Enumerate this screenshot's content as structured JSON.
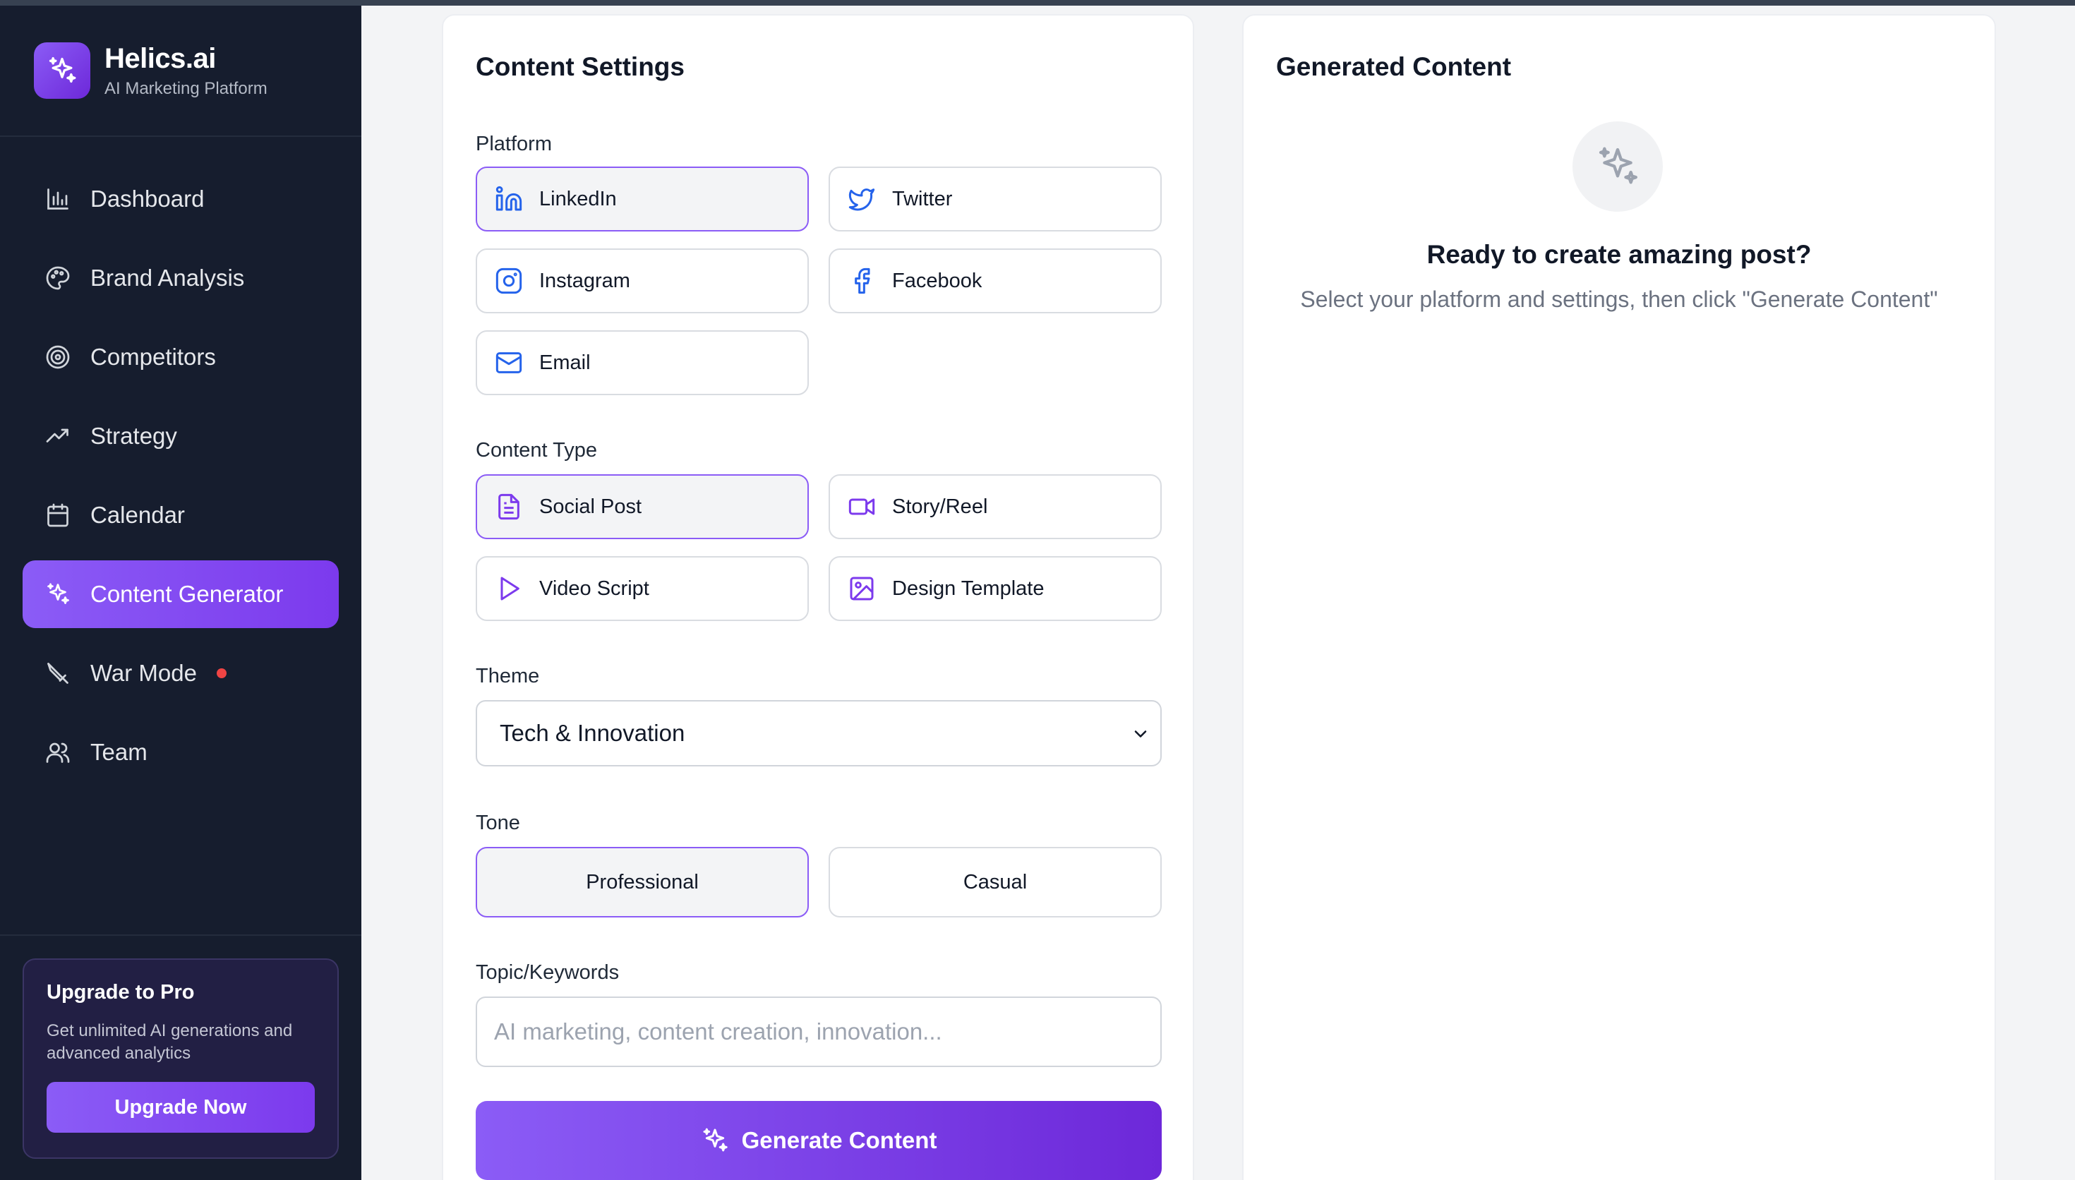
{
  "app": {
    "name": "Helics.ai",
    "subtitle": "AI Marketing Platform"
  },
  "colors": {
    "accent": "#7c3aed",
    "sidebar_bg": "#161d2e",
    "alert_dot": "#ef4444"
  },
  "sidebar": {
    "items": [
      {
        "label": "Dashboard",
        "icon": "bar-chart-icon"
      },
      {
        "label": "Brand Analysis",
        "icon": "palette-icon"
      },
      {
        "label": "Competitors",
        "icon": "target-icon"
      },
      {
        "label": "Strategy",
        "icon": "trending-up-icon"
      },
      {
        "label": "Calendar",
        "icon": "calendar-icon"
      },
      {
        "label": "Content Generator",
        "icon": "sparkles-icon",
        "active": true
      },
      {
        "label": "War Mode",
        "icon": "sword-icon",
        "alert": true
      },
      {
        "label": "Team",
        "icon": "users-icon"
      }
    ],
    "upgrade": {
      "title": "Upgrade to Pro",
      "description": "Get unlimited AI generations and advanced analytics",
      "button": "Upgrade Now"
    }
  },
  "settings": {
    "title": "Content Settings",
    "platform_label": "Platform",
    "platforms": [
      {
        "label": "LinkedIn",
        "icon": "linkedin-icon",
        "selected": true
      },
      {
        "label": "Twitter",
        "icon": "twitter-icon"
      },
      {
        "label": "Instagram",
        "icon": "instagram-icon"
      },
      {
        "label": "Facebook",
        "icon": "facebook-icon"
      },
      {
        "label": "Email",
        "icon": "mail-icon"
      }
    ],
    "content_type_label": "Content Type",
    "content_types": [
      {
        "label": "Social Post",
        "icon": "file-text-icon",
        "selected": true
      },
      {
        "label": "Story/Reel",
        "icon": "video-icon"
      },
      {
        "label": "Video Script",
        "icon": "play-icon"
      },
      {
        "label": "Design Template",
        "icon": "image-icon"
      }
    ],
    "theme_label": "Theme",
    "theme_value": "Tech & Innovation",
    "tone_label": "Tone",
    "tones": [
      {
        "label": "Professional",
        "selected": true
      },
      {
        "label": "Casual"
      }
    ],
    "topic_label": "Topic/Keywords",
    "topic_placeholder": "AI marketing, content creation, innovation...",
    "topic_value": "",
    "generate_button": "Generate Content"
  },
  "generated": {
    "title": "Generated Content",
    "empty_title": "Ready to create amazing post?",
    "empty_description": "Select your platform and settings, then click \"Generate Content\""
  }
}
